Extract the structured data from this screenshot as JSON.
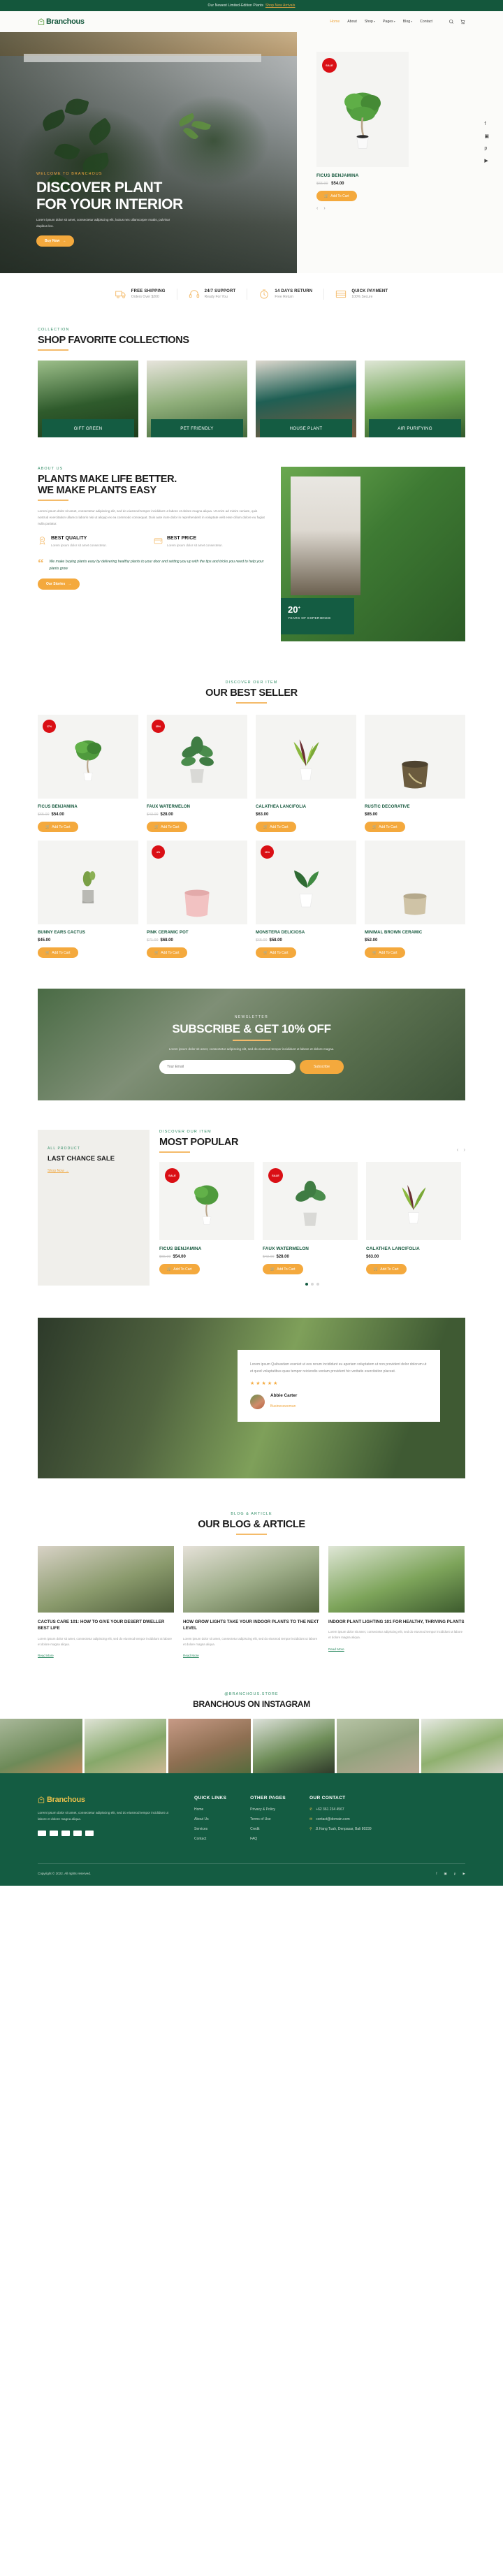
{
  "topbar": {
    "text": "Our Newest Limited-Edition Plants",
    "link": "Shop New Arrivals"
  },
  "header": {
    "brand": "Branchous",
    "nav": [
      {
        "label": "Home",
        "caret": "",
        "active": true
      },
      {
        "label": "About",
        "caret": "",
        "active": false
      },
      {
        "label": "Shop",
        "caret": "⌄",
        "active": false
      },
      {
        "label": "Pages",
        "caret": "⌄",
        "active": false
      },
      {
        "label": "Blog",
        "caret": "⌄",
        "active": false
      },
      {
        "label": "Contact",
        "caret": "",
        "active": false
      }
    ],
    "search_icon": "search-icon",
    "cart_icon": "cart-icon"
  },
  "hero": {
    "eyebrow": "WELCOME TO BRANCHOUS",
    "title_line1": "DISCOVER PLANT",
    "title_line2": "FOR YOUR INTERIOR",
    "subtitle": "Lorem ipsum dolor sit amet, consectetur adipiscing elit, luctus nec ullamcorper mattis, pulvinar dapibus leo.",
    "cta": "Buy Now",
    "product": {
      "badge": "SALE",
      "name": "FICUS BENJAMINA",
      "price_old": "$65.00",
      "price": "$54.00",
      "cart": "Add To Cart"
    },
    "socials": [
      "facebook-icon",
      "instagram-icon",
      "pinterest-icon",
      "youtube-icon"
    ]
  },
  "features": [
    {
      "icon": "truck-icon",
      "title": "FREE SHIPPING",
      "sub": "Orders Over $200"
    },
    {
      "icon": "headset-icon",
      "title": "24/7 SUPPORT",
      "sub": "Ready For You"
    },
    {
      "icon": "return-icon",
      "title": "14 DAYS RETURN",
      "sub": "Free Return"
    },
    {
      "icon": "card-icon",
      "title": "QUICK PAYMENT",
      "sub": "100% Secure"
    }
  ],
  "collections": {
    "eyebrow": "COLLECTION",
    "title": "SHOP FAVORITE COLLECTIONS",
    "items": [
      {
        "label": "GIFT GREEN"
      },
      {
        "label": "PET FRIENDLY"
      },
      {
        "label": "HOUSE PLANT"
      },
      {
        "label": "AIR PURIFYING"
      }
    ]
  },
  "about": {
    "eyebrow": "ABOUT US",
    "title_line1": "PLANTS MAKE LIFE BETTER.",
    "title_line2": "WE MAKE PLANTS EASY",
    "paragraph": "Lorem ipsum dolor sit amet, consectetur adipiscing elit, sed do eiusmod tempor incididunt ut labore et dolore magna aliqua. Ut enim ad minim veniam, quis nostrud exercitation ullamco laboris nisi ut aliquip ex ea commodo consequat. Duis aute irure dolor in reprehenderit in voluptate velit esse cillum dolore eu fugiat nulla pariatur.",
    "features": [
      {
        "icon": "quality-badge-icon",
        "title": "BEST QUALITY",
        "sub": "Lorem ipsum dolor sit amet consectetur."
      },
      {
        "icon": "wallet-icon",
        "title": "BEST PRICE",
        "sub": "Lorem ipsum dolor sit amet consectetur."
      }
    ],
    "quote": "We make buying plants easy by delivering healthy plants to your door and setting you up with the tips and tricks you need to help your plants grow",
    "cta": "Our Stories",
    "badge_number": "20",
    "badge_sup": "+",
    "badge_label": "YEARS OF EXPERIENCE"
  },
  "bestseller": {
    "eyebrow": "DISCOVER OUR ITEM",
    "title": "OUR BEST SELLER",
    "cart_label": "Add To Cart",
    "products": [
      {
        "badge": "17%",
        "name": "FICUS BENJAMINA",
        "price_old": "$65.00",
        "price": "$54.00"
      },
      {
        "badge": "35%",
        "name": "FAUX WATERMELON",
        "price_old": "$43.00",
        "price": "$28.00"
      },
      {
        "badge": "",
        "name": "CALATHEA LANCIFOLIA",
        "price_old": "",
        "price": "$63.00"
      },
      {
        "badge": "",
        "name": "RUSTIC DECORATIVE",
        "price_old": "",
        "price": "$85.00"
      },
      {
        "badge": "",
        "name": "BUNNY EARS CACTUS",
        "price_old": "",
        "price": "$45.00"
      },
      {
        "badge": "4%",
        "name": "PINK CERAMIC POT",
        "price_old": "$71.00",
        "price": "$68.00"
      },
      {
        "badge": "11%",
        "name": "MONSTERA DELICIOSA",
        "price_old": "$65.00",
        "price": "$58.00"
      },
      {
        "badge": "",
        "name": "MINIMAL BROWN CERAMIC",
        "price_old": "",
        "price": "$52.00"
      }
    ]
  },
  "newsletter": {
    "eyebrow": "NEWSLETTER",
    "title": "SUBSCRIBE & GET 10% OFF",
    "sub": "Lorem ipsum dolor sit amet, consectetur adipiscing elit, sed do eiusmod tempor incididunt ut labore et dolore magna.",
    "placeholder": "Your Email",
    "button": "Subscribe"
  },
  "most_popular": {
    "promo_eyebrow": "ALL PRODUCT",
    "promo_title": "LAST CHANCE SALE",
    "promo_link": "Shop Now",
    "eyebrow": "DISCOVER OUR ITEM",
    "title": "MOST POPULAR",
    "cart_label": "Add To Cart",
    "products": [
      {
        "badge": "SALE",
        "name": "FICUS BENJAMINA",
        "price_old": "$65.00",
        "price": "$54.00"
      },
      {
        "badge": "SALE",
        "name": "FAUX WATERMELON",
        "price_old": "$43.00",
        "price": "$28.00"
      },
      {
        "badge": "",
        "name": "CALATHEA LANCIFOLIA",
        "price_old": "",
        "price": "$63.00"
      }
    ]
  },
  "testimonial": {
    "text": "Lorem ipsum Quibusdam eveniet ut eos rerum incididunt eu aperiam voluptatem ut non provident dolor dolorum ut et quod voluptatibus quas tempor reiciendis veniam provident hic veritatis exercitation placeat.",
    "stars": "★★★★★",
    "name": "Abbie Carter",
    "role": "Businesswoman"
  },
  "blog": {
    "eyebrow": "BLOG & ARTICLE",
    "title": "OUR BLOG & ARTICLE",
    "read_more": "Read More",
    "posts": [
      {
        "title": "CACTUS CARE 101: HOW TO GIVE YOUR DESERT DWELLER BEST LIFE",
        "excerpt": "Lorem ipsum dolor sit amet, consectetur adipiscing elit, sed do eiusmod tempor incididunt ut labore et dolore magna aliqua."
      },
      {
        "title": "HOW GROW LIGHTS TAKE YOUR INDOOR PLANTS TO THE NEXT LEVEL",
        "excerpt": "Lorem ipsum dolor sit amet, consectetur adipiscing elit, sed do eiusmod tempor incididunt ut labore et dolore magna aliqua."
      },
      {
        "title": "INDOOR PLANT LIGHTING 101 FOR HEALTHY, THRIVING PLANTS",
        "excerpt": "Lorem ipsum dolor sit amet, consectetur adipiscing elit, sed do eiusmod tempor incididunt ut labore et dolore magna aliqua."
      }
    ]
  },
  "instagram": {
    "eyebrow": "@BRANCHOUS.STORE",
    "title": "BRANCHOUS ON INSTAGRAM"
  },
  "footer": {
    "brand": "Branchous",
    "about": "Lorem ipsum dolor sit amet, consectetur adipiscing elit, sed do eiusmod tempor incididunt ut labore et dolore magna aliqua.",
    "quick_links_title": "QUICK LINKS",
    "quick_links": [
      "Home",
      "About Us",
      "Services",
      "Contact"
    ],
    "other_pages_title": "OTHER PAGES",
    "other_pages": [
      "Privacy & Policy",
      "Terms of Use",
      "Credit",
      "FAQ"
    ],
    "contact_title": "OUR CONTACT",
    "contact": [
      {
        "icon": "phone-icon",
        "text": "+62 361 234 4567"
      },
      {
        "icon": "mail-icon",
        "text": "contact@domain.com"
      },
      {
        "icon": "pin-icon",
        "text": "Jl.Hang Tuah, Denpasar, Bali 80239"
      }
    ],
    "copyright": "Copyright © 2022. All rights reserved.",
    "socials": [
      "facebook-icon",
      "instagram-icon",
      "pinterest-icon",
      "youtube-icon"
    ]
  },
  "colors": {
    "green": "#145c42",
    "orange": "#f4a93d",
    "gold": "#e9bf4a",
    "sale_red": "#da0f15"
  }
}
